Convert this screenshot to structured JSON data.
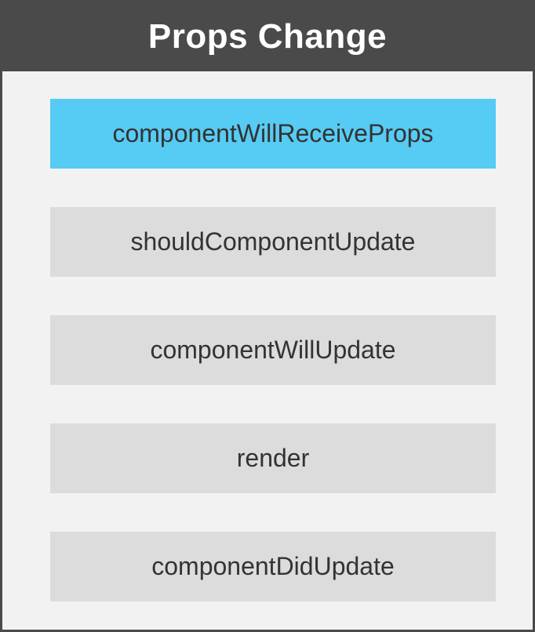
{
  "title": "Props Change",
  "colors": {
    "header_bg": "#4a4a4a",
    "panel_bg": "#f2f2f2",
    "step_bg": "#dcdcdc",
    "active_step_bg": "#56cbf4"
  },
  "steps": [
    {
      "label": "componentWillReceiveProps",
      "active": true
    },
    {
      "label": "shouldComponentUpdate",
      "active": false
    },
    {
      "label": "componentWillUpdate",
      "active": false
    },
    {
      "label": "render",
      "active": false
    },
    {
      "label": "componentDidUpdate",
      "active": false
    }
  ]
}
